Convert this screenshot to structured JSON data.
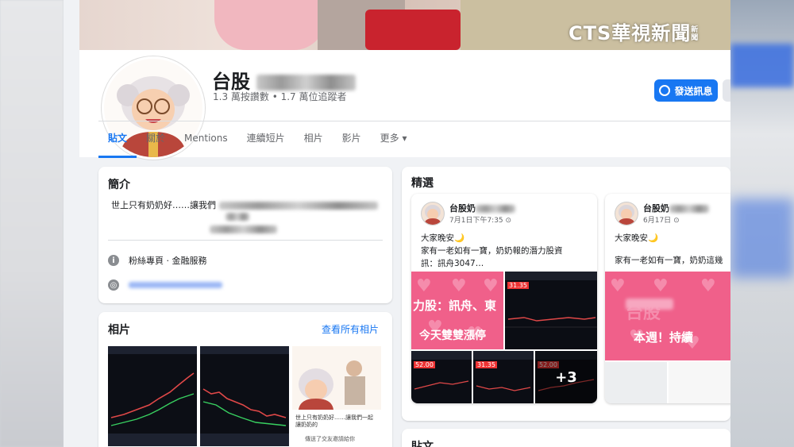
{
  "watermark": {
    "brand": "CTS華視新聞",
    "sub": "新聞"
  },
  "page": {
    "name": "台股",
    "stats": "1.3 萬按讚數 • 1.7 萬位追蹤者",
    "message_button": "發送訊息"
  },
  "tabs": [
    {
      "label": "貼文"
    },
    {
      "label": "關於"
    },
    {
      "label": "Mentions"
    },
    {
      "label": "連續短片"
    },
    {
      "label": "相片"
    },
    {
      "label": "影片"
    },
    {
      "label": "更多 ▾"
    }
  ],
  "intro": {
    "title": "簡介",
    "bio": "世上只有奶奶好……讓我們",
    "category": "粉絲專頁 · 金融服務"
  },
  "photos": {
    "title": "相片",
    "see_all": "查看所有相片",
    "photo3_caption": "世上只有奶奶好……讓我們一起讓奶奶的",
    "photo3_button": "傳送了交友邀請給你"
  },
  "featured": {
    "title": "精選",
    "posts": [
      {
        "author": "台股奶",
        "time": "7月1日下午7:35",
        "line1": "大家晚安🌙",
        "line2": "家有一老如有一寶，奶奶報的潛力股資",
        "line3": "訊：訊舟3047…",
        "promo1": "力股：訊舟、東",
        "promo2": "今天雙雙漲停",
        "price1": "31.35",
        "price2": "52.00",
        "price3": "31.35",
        "price4": "52.00",
        "more": "+3"
      },
      {
        "author": "台股奶",
        "time": "6月17日",
        "line1": "大家晚安🌙",
        "line2": "家有一老如有一寶，奶奶這幾",
        "promo1": "台股",
        "promo2": "本週！持續"
      }
    ]
  },
  "posts_section": {
    "title": "貼文"
  },
  "colors": {
    "accent": "#1877f2",
    "hearts": "#f0608a",
    "price": "#e33333"
  }
}
